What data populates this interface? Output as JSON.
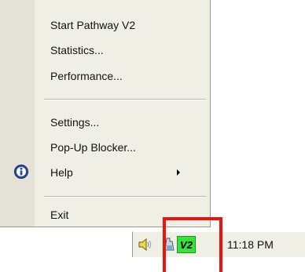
{
  "menu": {
    "items": [
      {
        "label": "Start Pathway V2"
      },
      {
        "label": "Statistics..."
      },
      {
        "label": "Performance..."
      },
      {
        "label": "Settings..."
      },
      {
        "label": "Pop-Up Blocker..."
      },
      {
        "label": "Help",
        "icon": "info-icon",
        "has_submenu": true
      },
      {
        "label": "Exit"
      }
    ]
  },
  "tray": {
    "icons": [
      "speaker-icon",
      "app-icon",
      "pathway-v2-icon"
    ],
    "pathway_badge": "V2",
    "clock": "11:18 PM"
  },
  "colors": {
    "highlight": "#e8150f",
    "menu_background": "#f0efe6",
    "pathway_icon_green": "#35e23a"
  }
}
